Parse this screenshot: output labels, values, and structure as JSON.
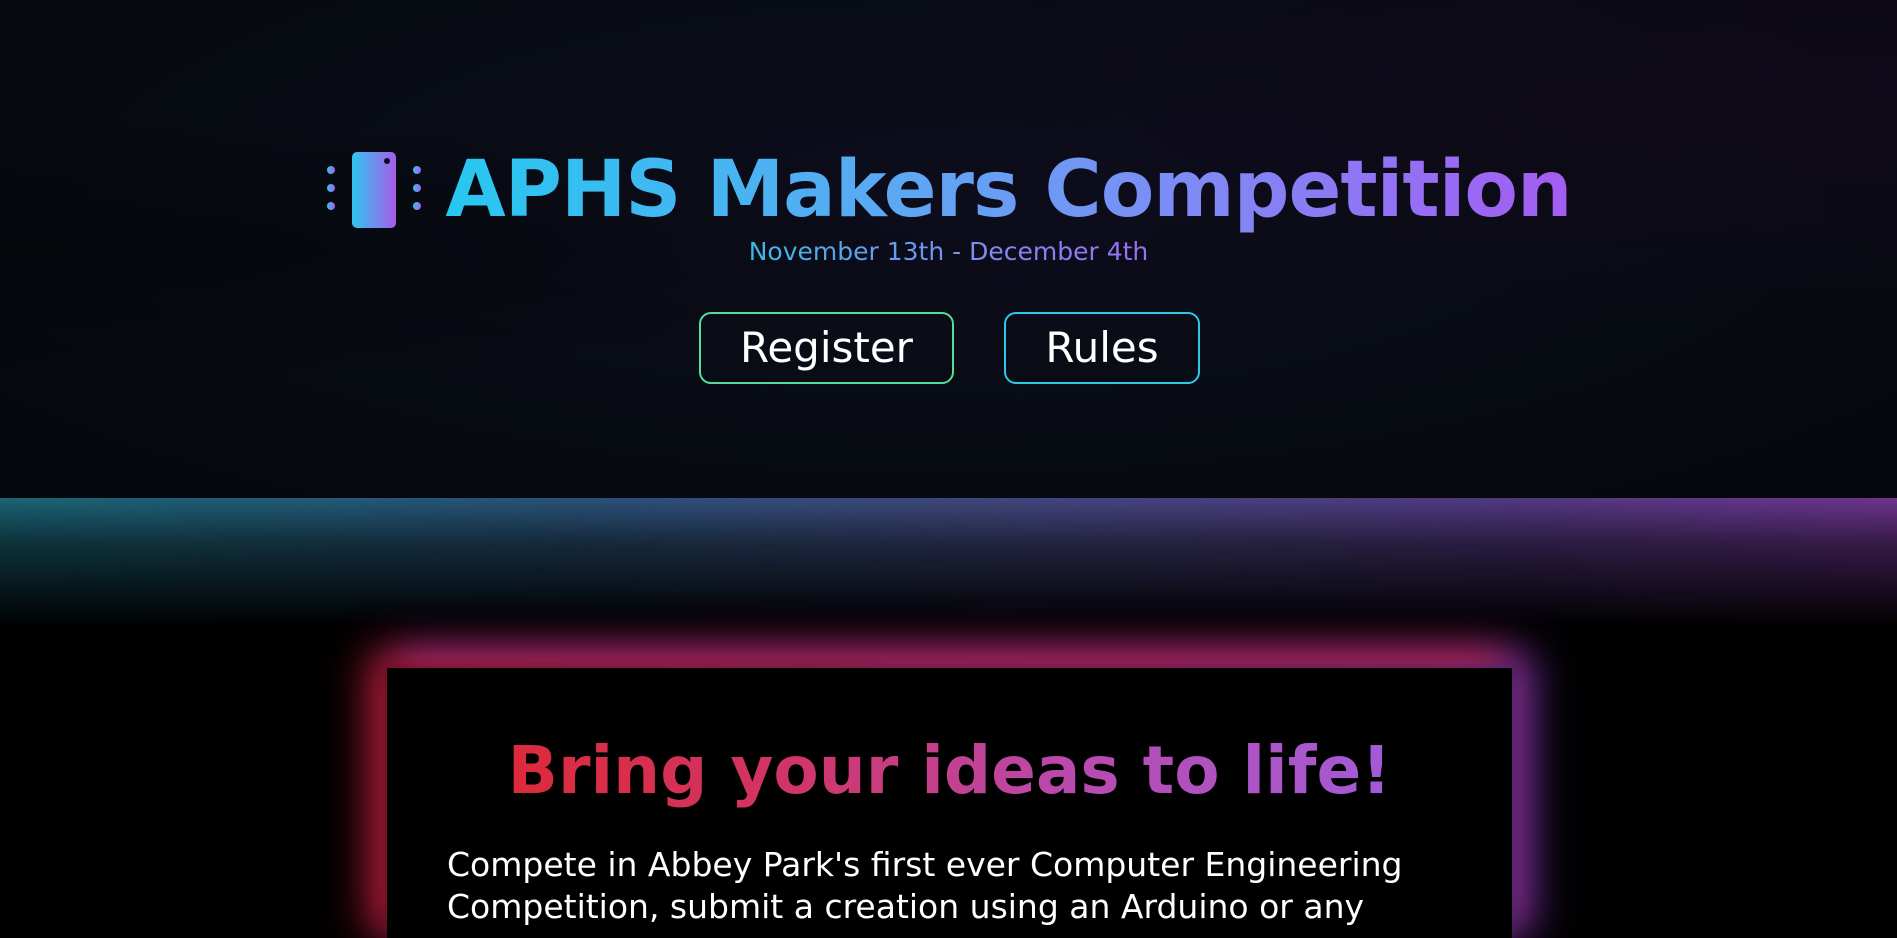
{
  "hero": {
    "title": "APHS Makers Competition",
    "dates": "November 13th - December 4th",
    "icon": "microchip-icon",
    "buttons": {
      "register_label": "Register",
      "rules_label": "Rules"
    }
  },
  "intro": {
    "heading": "Bring your ideas to life!",
    "text": "Compete in Abbey Park's first ever Computer Engineering Competition, submit a creation using an Arduino or any"
  },
  "colors": {
    "background": "#000000",
    "title_gradient_start": "#26c8f0",
    "title_gradient_end": "#a45cf2",
    "register_border": "#55dc9a",
    "rules_border": "#2ec7e8",
    "heading_gradient_start": "#dc2a3a",
    "heading_gradient_end": "#a35bd6"
  }
}
